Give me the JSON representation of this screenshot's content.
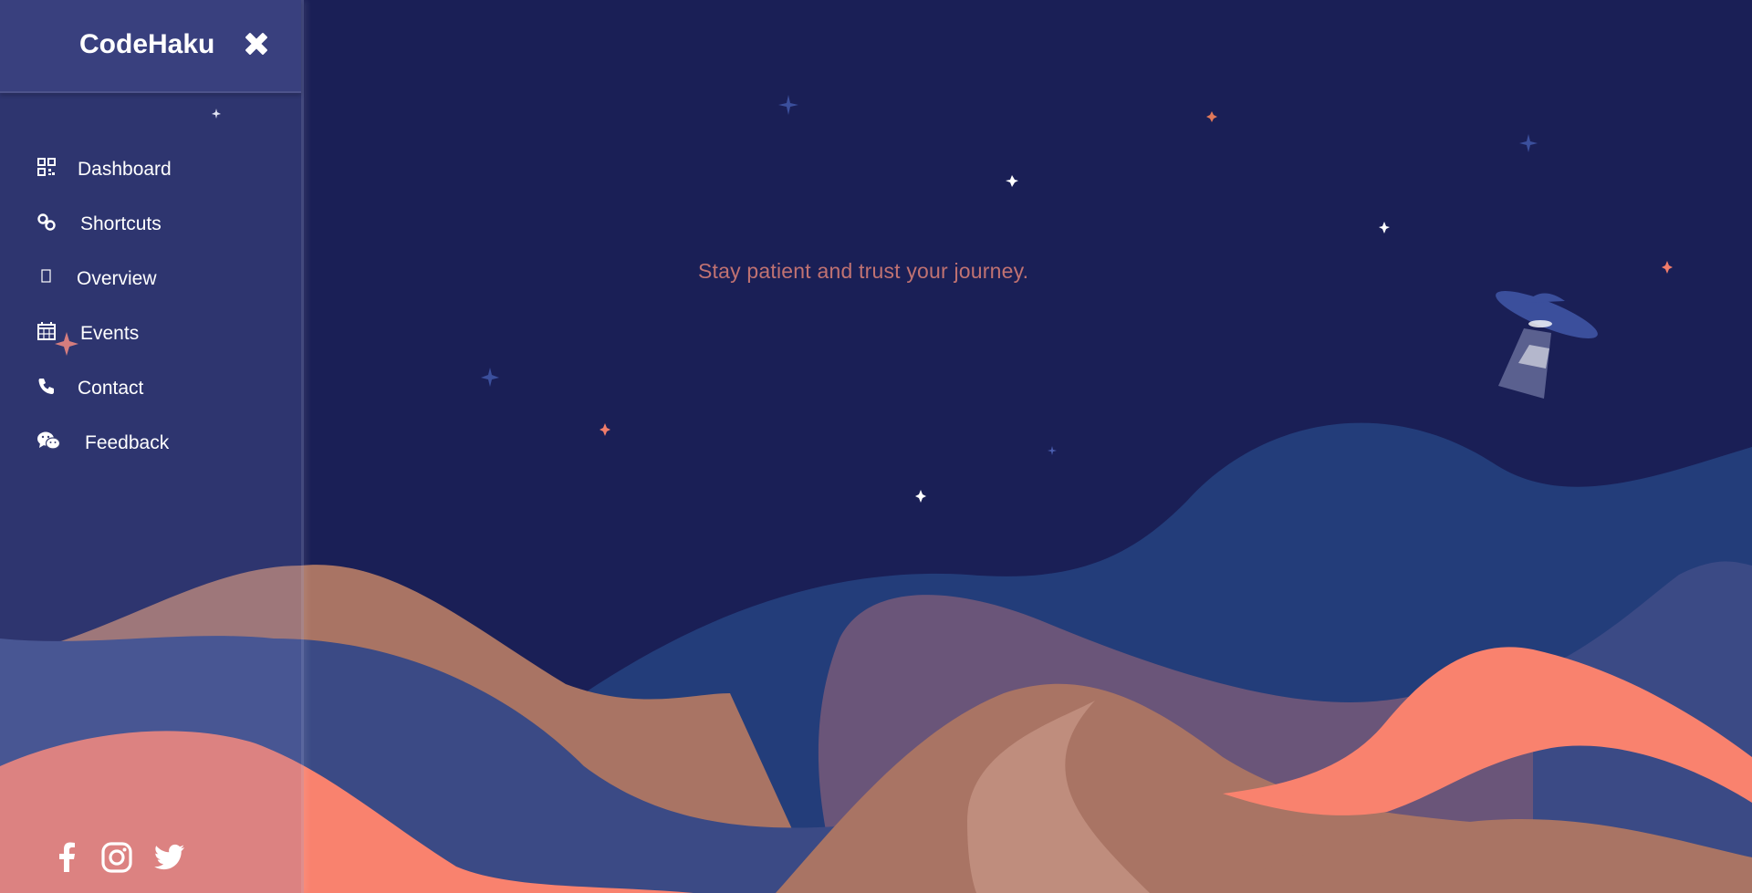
{
  "sidebar": {
    "brand": "CodeHaku",
    "close_icon": "close-x-icon",
    "items": [
      {
        "label": "Dashboard",
        "icon": "qr-grid-icon"
      },
      {
        "label": "Shortcuts",
        "icon": "link-icon"
      },
      {
        "label": "Overview",
        "icon": "square-icon"
      },
      {
        "label": "Events",
        "icon": "calendar-icon"
      },
      {
        "label": "Contact",
        "icon": "phone-icon"
      },
      {
        "label": "Feedback",
        "icon": "wechat-icon"
      }
    ],
    "socials": [
      {
        "name": "facebook",
        "icon": "facebook-icon"
      },
      {
        "name": "instagram",
        "icon": "instagram-icon"
      },
      {
        "name": "twitter",
        "icon": "twitter-icon"
      }
    ]
  },
  "main": {
    "quote": "Stay patient and trust your journey."
  },
  "colors": {
    "sky": "#1a1f56",
    "quote": "#c07272",
    "coral": "#f9826e",
    "dune": "#a97464",
    "hill_blue": "#233d7a",
    "hill_purple": "#6a5579",
    "hill_indigo": "#3b4a85",
    "sand_light": "#bf8d7d"
  }
}
